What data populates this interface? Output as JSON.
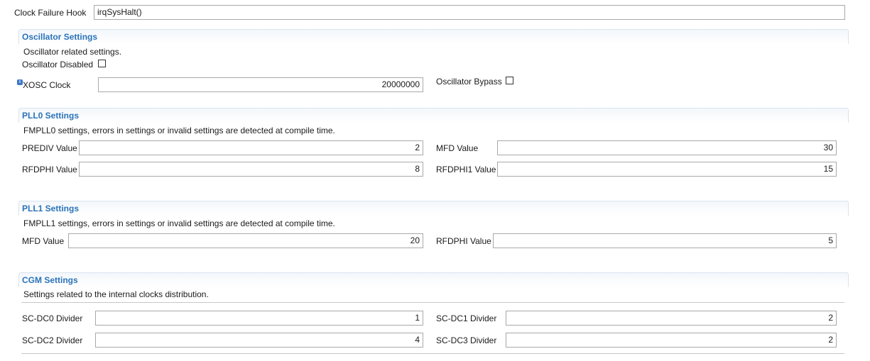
{
  "clock_failure": {
    "label": "Clock Failure Hook",
    "value": "irqSysHalt()"
  },
  "oscillator": {
    "title": "Oscillator Settings",
    "description": "Oscillator related settings.",
    "disabled_label": "Oscillator Disabled",
    "disabled_checked": false,
    "xosc_label": "XOSC Clock",
    "xosc_value": "20000000",
    "bypass_label": "Oscillator Bypass",
    "bypass_checked": false,
    "info_icon": "info-icon"
  },
  "pll0": {
    "title": "PLL0 Settings",
    "description": "FMPLL0 settings, errors in settings or invalid settings are detected at compile time.",
    "prediv_label": "PREDIV Value",
    "prediv_value": "2",
    "mfd_label": "MFD Value",
    "mfd_value": "30",
    "rfdphi_label": "RFDPHI Value",
    "rfdphi_value": "8",
    "rfdphi1_label": "RFDPHI1 Value",
    "rfdphi1_value": "15"
  },
  "pll1": {
    "title": "PLL1 Settings",
    "description": "FMPLL1 settings, errors in settings or invalid settings are detected at compile time.",
    "mfd_label": "MFD Value",
    "mfd_value": "20",
    "rfdphi_label": "RFDPHI Value",
    "rfdphi_value": "5"
  },
  "cgm": {
    "title": "CGM Settings",
    "description": "Settings related to the internal clocks distribution.",
    "dc0_label": "SC-DC0 Divider",
    "dc0_value": "1",
    "dc1_label": "SC-DC1 Divider",
    "dc1_value": "2",
    "dc2_label": "SC-DC2 Divider",
    "dc2_value": "4",
    "dc3_label": "SC-DC3 Divider",
    "dc3_value": "2"
  },
  "colors": {
    "section_title": "#2a73b8",
    "info_icon": "#3b77c8"
  }
}
